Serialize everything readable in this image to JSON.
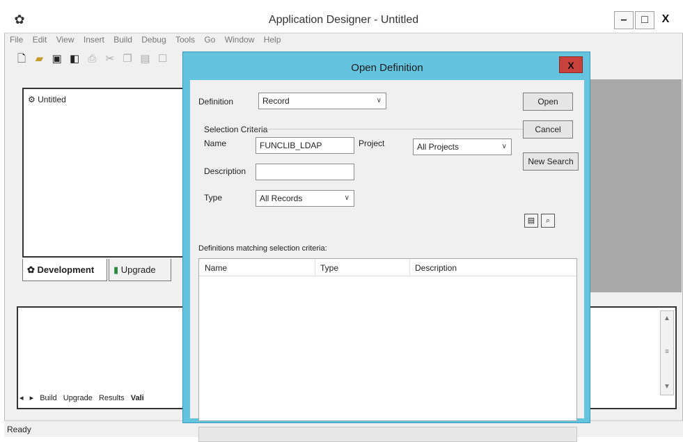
{
  "window": {
    "title": "Application Designer - Untitled",
    "app_icon": "app-icon",
    "minimize": "–",
    "maximize": "□",
    "close": "X"
  },
  "menu": [
    "File",
    "Edit",
    "View",
    "Insert",
    "Build",
    "Debug",
    "Tools",
    "Go",
    "Window",
    "Help"
  ],
  "toolbar_icons": [
    "new-icon",
    "open-icon",
    "save-icon",
    "save-all-icon",
    "print-icon",
    "cut-icon",
    "copy-icon",
    "paste-icon",
    "properties-icon"
  ],
  "project_pane": {
    "tree_item": "Untitled",
    "tabs": [
      "Development",
      "Upgrade"
    ]
  },
  "output_pane": {
    "tabs": [
      "Build",
      "Upgrade",
      "Results",
      "Vali"
    ]
  },
  "status_bar": {
    "text": "Ready"
  },
  "dialog": {
    "title": "Open Definition",
    "close": "X",
    "definition_label": "Definition",
    "definition_value": "Record",
    "selection_criteria_label": "Selection Criteria",
    "name_label": "Name",
    "name_value": "FUNCLIB_LDAP",
    "project_label": "Project",
    "project_value": "All Projects",
    "description_label": "Description",
    "description_value": "",
    "type_label": "Type",
    "type_value": "All Records",
    "buttons": {
      "open": "Open",
      "cancel": "Cancel",
      "new_search": "New Search"
    },
    "results_label": "Definitions matching selection criteria:",
    "columns": [
      "Name",
      "Type",
      "Description"
    ]
  },
  "colors": {
    "dialog_frame": "#64c4e0",
    "dialog_close": "#c9413b",
    "workspace_gray": "#a9a9a9"
  }
}
